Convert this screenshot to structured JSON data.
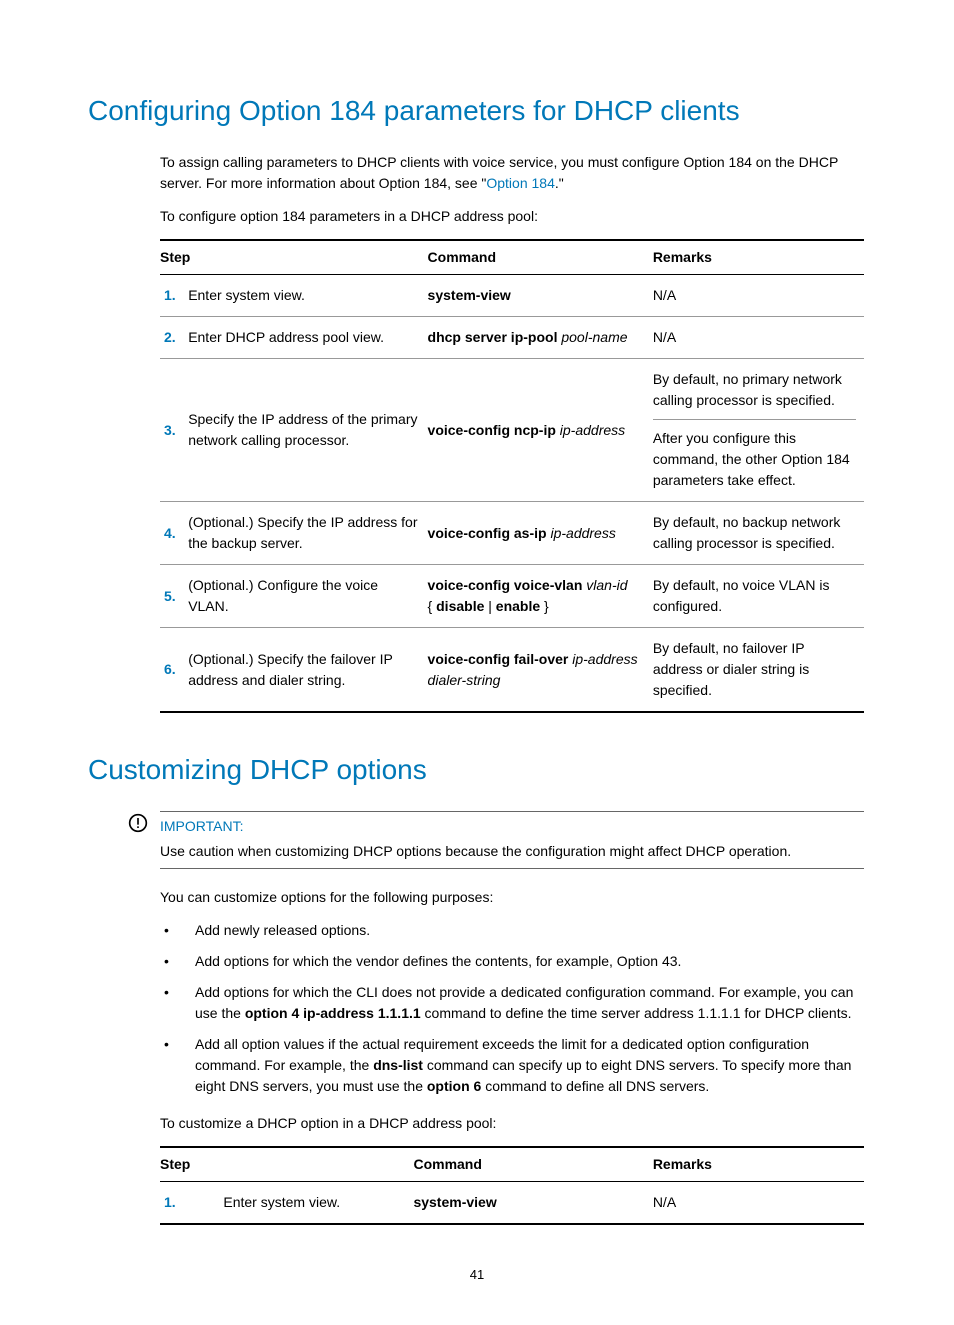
{
  "h1a": "Configuring Option 184 parameters for DHCP clients",
  "p1_pre": "To assign calling parameters to DHCP clients with voice service, you must configure Option 184 on the DHCP server. For more information about Option 184, see \"",
  "p1_link": "Option 184",
  "p1_post": ".\"",
  "p2": "To configure option 184 parameters in a DHCP address pool:",
  "t1": {
    "h_step": "Step",
    "h_cmd": "Command",
    "h_rem": "Remarks",
    "r1": {
      "n": "1.",
      "step": "Enter system view.",
      "cmdb": "system-view",
      "cmdi": "",
      "rem": "N/A"
    },
    "r2": {
      "n": "2.",
      "step": "Enter DHCP address pool view.",
      "cmdb": "dhcp server ip-pool ",
      "cmdi": "pool-name",
      "rem": "N/A"
    },
    "r3": {
      "n": "3.",
      "step": "Specify the IP address of the primary network calling processor.",
      "cmdb": "voice-config ncp-ip ",
      "cmdi": "ip-address",
      "rem1": "By default, no primary network calling processor is specified.",
      "rem2": "After you configure this command, the other Option 184 parameters take effect."
    },
    "r4": {
      "n": "4.",
      "step": "(Optional.) Specify the IP address for the backup server.",
      "cmdb": "voice-config as-ip ",
      "cmdi": "ip-address",
      "rem": "By default, no backup network calling processor is specified."
    },
    "r5": {
      "n": "5.",
      "step": "(Optional.) Configure the voice VLAN.",
      "cmdb": "voice-config voice-vlan ",
      "cmdi": "vlan-id",
      "cmdb2": "disable",
      "cmdb3": "enable",
      "rem": "By default, no voice VLAN is configured."
    },
    "r6": {
      "n": "6.",
      "step": "(Optional.) Specify the failover IP address and dialer string.",
      "cmdb": "voice-config fail-over ",
      "cmdi": "ip-address dialer-string",
      "rem": "By default, no failover IP address or dialer string is specified."
    }
  },
  "h1b": "Customizing DHCP options",
  "imp_label": "IMPORTANT:",
  "imp_text": "Use caution when customizing DHCP options because the configuration might affect DHCP operation.",
  "p3": "You can customize options for the following purposes:",
  "bullets": {
    "b1": "Add newly released options.",
    "b2": "Add options for which the vendor defines the contents, for example, Option 43.",
    "b3_pre": "Add options for which the CLI does not provide a dedicated configuration command. For example, you can use the ",
    "b3_bold": "option 4 ip-address 1.1.1.1",
    "b3_post": " command to define the time server address 1.1.1.1 for DHCP clients.",
    "b4_pre": "Add all option values if the actual requirement exceeds the limit for a dedicated option configuration command. For example, the ",
    "b4_bold1": "dns-list",
    "b4_mid": " command can specify up to eight DNS servers. To specify more than eight DNS servers, you must use the ",
    "b4_bold2": "option 6",
    "b4_post": " command to define all DNS servers."
  },
  "p4": "To customize a DHCP option in a DHCP address pool:",
  "t2": {
    "h_step": "Step",
    "h_cmd": "Command",
    "h_rem": "Remarks",
    "r1": {
      "n": "1.",
      "step": "Enter system view.",
      "cmdb": "system-view",
      "rem": "N/A"
    }
  },
  "page_num": "41"
}
